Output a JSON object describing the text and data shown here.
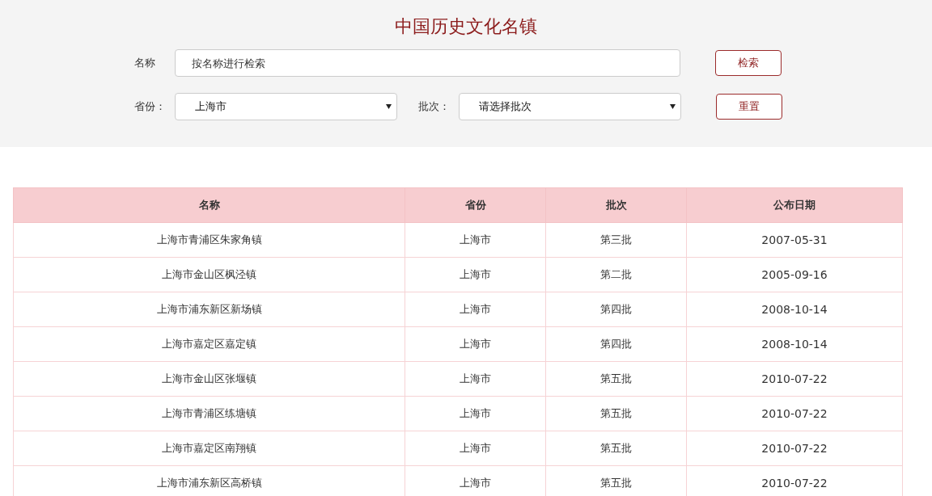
{
  "title": "中国历史文化名镇",
  "search": {
    "label": "名称",
    "placeholder": "按名称进行检索",
    "button": "检索"
  },
  "filters": [
    {
      "label": "省份：",
      "value": "上海市"
    },
    {
      "label": "批次：",
      "value": "请选择批次"
    }
  ],
  "reset_button": "重置",
  "table": {
    "columns": [
      "名称",
      "省份",
      "批次",
      "公布日期"
    ],
    "rows": [
      [
        "上海市青浦区朱家角镇",
        "上海市",
        "第三批",
        "2007-05-31"
      ],
      [
        "上海市金山区枫泾镇",
        "上海市",
        "第二批",
        "2005-09-16"
      ],
      [
        "上海市浦东新区新场镇",
        "上海市",
        "第四批",
        "2008-10-14"
      ],
      [
        "上海市嘉定区嘉定镇",
        "上海市",
        "第四批",
        "2008-10-14"
      ],
      [
        "上海市金山区张堰镇",
        "上海市",
        "第五批",
        "2010-07-22"
      ],
      [
        "上海市青浦区练塘镇",
        "上海市",
        "第五批",
        "2010-07-22"
      ],
      [
        "上海市嘉定区南翔镇",
        "上海市",
        "第五批",
        "2010-07-22"
      ],
      [
        "上海市浦东新区高桥镇",
        "上海市",
        "第五批",
        "2010-07-22"
      ]
    ]
  }
}
